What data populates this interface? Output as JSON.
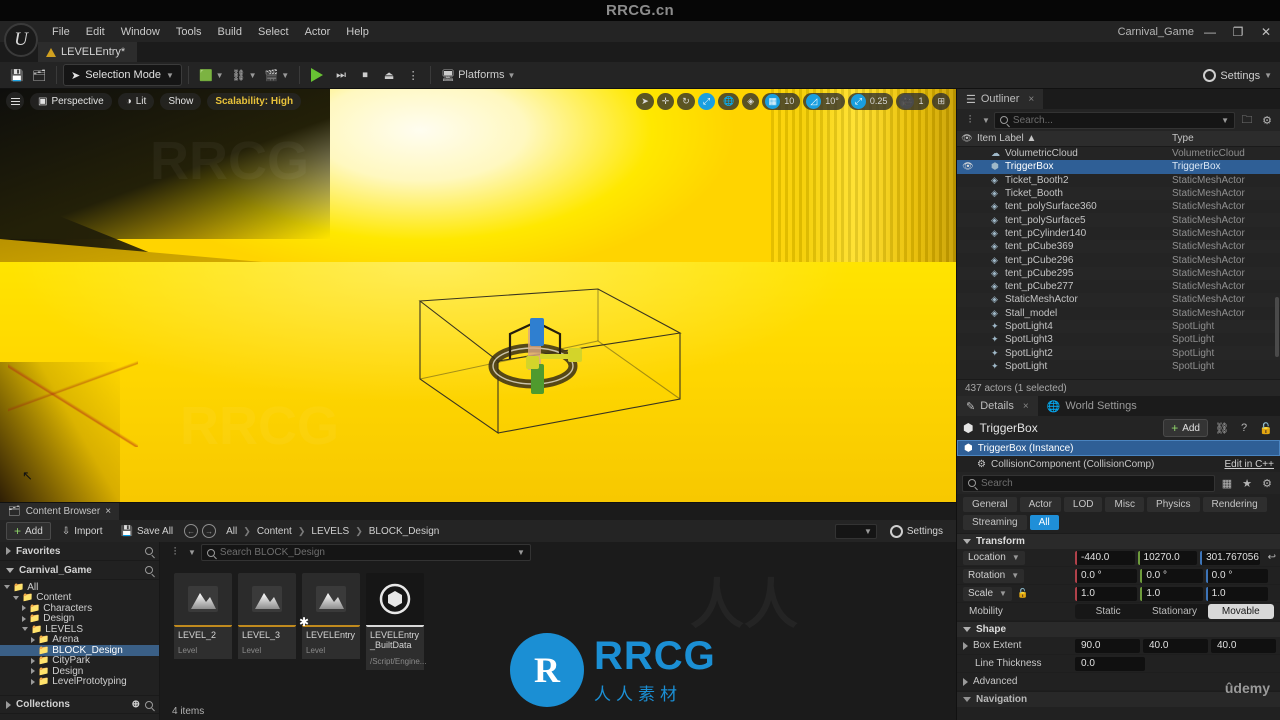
{
  "watermarks": {
    "top": "RRCG.cn",
    "brand_big": "RRCG",
    "brand_small": "人人素材",
    "brand_mark": "R",
    "udemy": "ûdemy"
  },
  "window": {
    "project_title": "Carnival_Game",
    "minimize": "—",
    "maximize": "❐",
    "close": "✕"
  },
  "menubar": {
    "items": [
      "File",
      "Edit",
      "Window",
      "Tools",
      "Build",
      "Select",
      "Actor",
      "Help"
    ]
  },
  "level_tab": {
    "label": "LEVELEntry*"
  },
  "toolbar": {
    "save_icon": "save-icon",
    "browse_icon": "browse-icon",
    "mode_label": "Selection Mode",
    "create_icon": "create-actor-icon",
    "blueprint_icon": "blueprints-icon",
    "cinematics_icon": "cinematics-icon",
    "play_label": "Play",
    "step_label": "Skip",
    "stop_label": "Stop",
    "eject_label": "Eject",
    "more_label": "⋮",
    "platforms_label": "Platforms",
    "settings_label": "Settings"
  },
  "viewport": {
    "menu_icon": "viewport-menu-icon",
    "perspective": "Perspective",
    "lit": "Lit",
    "show": "Show",
    "scalability": "Scalability: High",
    "right_controls": {
      "select_icon": "cursor-select-icon",
      "translate_icon": "translate-icon",
      "rotate_icon": "rotate-icon",
      "scale_icon": "scale-icon",
      "world_icon": "world-coords-icon",
      "surface_snap_icon": "surface-snap-icon",
      "grid_snap_value": "10",
      "angle_snap_value": "10°",
      "scale_snap_value": "0.25",
      "camera_speed_value": "1",
      "layout_icon": "viewport-layout-icon"
    }
  },
  "outliner": {
    "tab_label": "Outliner",
    "close": "×",
    "search_placeholder": "Search...",
    "filter_icon": "filter-icon",
    "new_folder_icon": "new-folder-icon",
    "settings_icon": "settings-icon",
    "col_label": "Item Label",
    "col_sort": "▲",
    "col_type": "Type",
    "eye_icon": "eye-icon",
    "rows": [
      {
        "name": "SpotLight",
        "type": "SpotLight",
        "icon": "spotlight-icon",
        "selected": false
      },
      {
        "name": "SpotLight2",
        "type": "SpotLight",
        "icon": "spotlight-icon",
        "selected": false
      },
      {
        "name": "SpotLight3",
        "type": "SpotLight",
        "icon": "spotlight-icon",
        "selected": false
      },
      {
        "name": "SpotLight4",
        "type": "SpotLight",
        "icon": "spotlight-icon",
        "selected": false
      },
      {
        "name": "Stall_model",
        "type": "StaticMeshActor",
        "icon": "mesh-icon",
        "selected": false
      },
      {
        "name": "StaticMeshActor",
        "type": "StaticMeshActor",
        "icon": "mesh-icon",
        "selected": false
      },
      {
        "name": "tent_pCube277",
        "type": "StaticMeshActor",
        "icon": "mesh-icon",
        "selected": false
      },
      {
        "name": "tent_pCube295",
        "type": "StaticMeshActor",
        "icon": "mesh-icon",
        "selected": false
      },
      {
        "name": "tent_pCube296",
        "type": "StaticMeshActor",
        "icon": "mesh-icon",
        "selected": false
      },
      {
        "name": "tent_pCube369",
        "type": "StaticMeshActor",
        "icon": "mesh-icon",
        "selected": false
      },
      {
        "name": "tent_pCylinder140",
        "type": "StaticMeshActor",
        "icon": "mesh-icon",
        "selected": false
      },
      {
        "name": "tent_polySurface5",
        "type": "StaticMeshActor",
        "icon": "mesh-icon",
        "selected": false
      },
      {
        "name": "tent_polySurface360",
        "type": "StaticMeshActor",
        "icon": "mesh-icon",
        "selected": false
      },
      {
        "name": "Ticket_Booth",
        "type": "StaticMeshActor",
        "icon": "mesh-icon",
        "selected": false
      },
      {
        "name": "Ticket_Booth2",
        "type": "StaticMeshActor",
        "icon": "mesh-icon",
        "selected": false
      },
      {
        "name": "TriggerBox",
        "type": "TriggerBox",
        "icon": "triggerbox-icon",
        "selected": true
      },
      {
        "name": "VolumetricCloud",
        "type": "VolumetricCloud",
        "icon": "cloud-icon",
        "selected": false
      }
    ],
    "status": "437 actors (1 selected)"
  },
  "details": {
    "tab_label": "Details",
    "close": "×",
    "world_settings_tab": "World Settings",
    "actor_name": "TriggerBox",
    "add_label": "Add",
    "components": [
      {
        "label": "TriggerBox (Instance)",
        "selected": true,
        "edit": ""
      },
      {
        "label": "CollisionComponent (CollisionComp)",
        "selected": false,
        "edit": "Edit in C++"
      }
    ],
    "search_placeholder": "Search",
    "filters": [
      "General",
      "Actor",
      "LOD",
      "Misc",
      "Physics",
      "Rendering",
      "Streaming",
      "All"
    ],
    "active_filter": "All",
    "transform": {
      "section": "Transform",
      "location_label": "Location",
      "location": [
        "-440.0",
        "10270.0",
        "301.767056"
      ],
      "rotation_label": "Rotation",
      "rotation": [
        "0.0 °",
        "0.0 °",
        "0.0 °"
      ],
      "scale_label": "Scale",
      "scale": [
        "1.0",
        "1.0",
        "1.0"
      ],
      "mobility_label": "Mobility",
      "mobility_options": [
        "Static",
        "Stationary",
        "Movable"
      ],
      "mobility_active": "Movable"
    },
    "shape": {
      "section": "Shape",
      "box_extent_label": "Box Extent",
      "box_extent": [
        "90.0",
        "40.0",
        "40.0"
      ],
      "line_thickness_label": "Line Thickness",
      "line_thickness": "0.0"
    },
    "advanced_label": "Advanced",
    "navigation_label": "Navigation"
  },
  "content_browser": {
    "tab_label": "Content Browser",
    "close": "×",
    "add_label": "Add",
    "import_label": "Import",
    "save_all_label": "Save All",
    "back_icon": "back-arrow-icon",
    "forward_icon": "forward-arrow-icon",
    "breadcrumb": [
      "All",
      "Content",
      "LEVELS",
      "BLOCK_Design"
    ],
    "settings_label": "Settings",
    "favorites_label": "Favorites",
    "project_label": "Carnival_Game",
    "collections_label": "Collections",
    "search_placeholder": "Search BLOCK_Design",
    "tree": [
      {
        "label": "All",
        "depth": 0,
        "state": "open",
        "selected": false
      },
      {
        "label": "Content",
        "depth": 1,
        "state": "open",
        "selected": false
      },
      {
        "label": "Characters",
        "depth": 2,
        "state": "closed",
        "selected": false
      },
      {
        "label": "Design",
        "depth": 2,
        "state": "closed",
        "selected": false
      },
      {
        "label": "LEVELS",
        "depth": 2,
        "state": "open",
        "selected": false
      },
      {
        "label": "Arena",
        "depth": 3,
        "state": "closed",
        "selected": false
      },
      {
        "label": "BLOCK_Design",
        "depth": 3,
        "state": "leaf",
        "selected": true
      },
      {
        "label": "CityPark",
        "depth": 3,
        "state": "closed",
        "selected": false
      },
      {
        "label": "Design",
        "depth": 3,
        "state": "closed",
        "selected": false
      },
      {
        "label": "LevelPrototyping",
        "depth": 3,
        "state": "closed",
        "selected": false
      }
    ],
    "assets": [
      {
        "name": "LEVEL_2",
        "type": "Level",
        "kind": "level",
        "dirty": false
      },
      {
        "name": "LEVEL_3",
        "type": "Level",
        "kind": "level",
        "dirty": false
      },
      {
        "name": "LEVELEntry",
        "type": "Level",
        "kind": "level",
        "dirty": true
      },
      {
        "name": "LEVELEntry_BuiltData",
        "type": "/Script/Engine...",
        "kind": "data",
        "dirty": false
      }
    ],
    "status": "4 items"
  }
}
